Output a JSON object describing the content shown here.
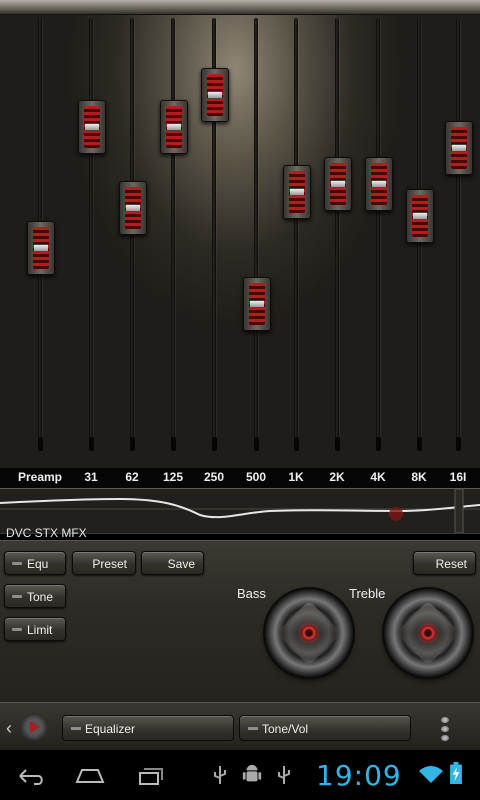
{
  "equalizer": {
    "bands": [
      {
        "label": "Preamp",
        "level": 0.5
      },
      {
        "label": "31",
        "level": 0.8
      },
      {
        "label": "62",
        "level": 0.6
      },
      {
        "label": "125",
        "level": 0.8
      },
      {
        "label": "250",
        "level": 0.88
      },
      {
        "label": "500",
        "level": 0.36
      },
      {
        "label": "1K",
        "level": 0.64
      },
      {
        "label": "2K",
        "level": 0.66
      },
      {
        "label": "4K",
        "level": 0.66
      },
      {
        "label": "8K",
        "level": 0.58
      },
      {
        "label": "16I",
        "level": 0.75
      }
    ]
  },
  "mode_text": "DVC STX MFX",
  "buttons": {
    "equ": "Equ",
    "tone": "Tone",
    "limit": "Limit",
    "preset": "Preset",
    "save": "Save",
    "reset": "Reset"
  },
  "knobs": {
    "bass_label": "Bass",
    "treble_label": "Treble"
  },
  "tabs": {
    "equalizer": "Equalizer",
    "tone_vol": "Tone/Vol"
  },
  "status_bar": {
    "time": "19:09"
  },
  "colors": {
    "accent_red": "#b21d1d",
    "clock_blue": "#33b5e5"
  }
}
